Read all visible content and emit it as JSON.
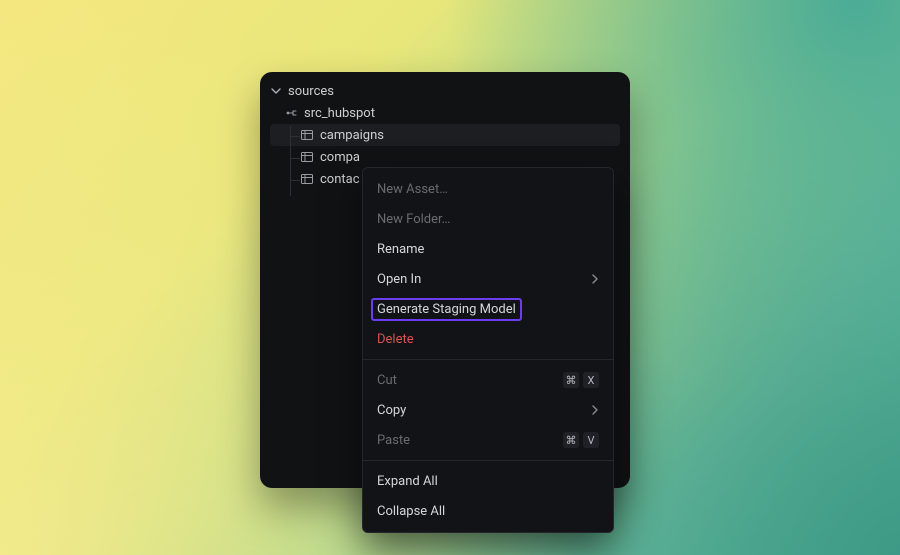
{
  "tree": {
    "root_label": "sources",
    "source_label": "src_hubspot",
    "items": [
      "campaigns",
      "compa",
      "contac"
    ]
  },
  "menu": {
    "new_asset": "New Asset…",
    "new_folder": "New Folder…",
    "rename": "Rename",
    "open_in": "Open In",
    "generate": "Generate Staging Model",
    "delete": "Delete",
    "cut": "Cut",
    "copy": "Copy",
    "paste": "Paste",
    "expand_all": "Expand All",
    "collapse_all": "Collapse All",
    "shortcut_cut": [
      "⌘",
      "X"
    ],
    "shortcut_paste": [
      "⌘",
      "V"
    ]
  }
}
